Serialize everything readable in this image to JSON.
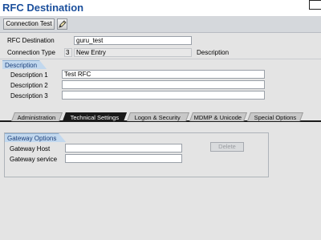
{
  "window": {
    "title": "RFC Destination"
  },
  "toolbar": {
    "connection_test_label": "Connection Test",
    "edit_icon": "pencil-icon"
  },
  "header": {
    "rfc_destination_label": "RFC Destination",
    "rfc_destination_value": "guru_test",
    "connection_type_label": "Connection Type",
    "connection_type_code": "3",
    "connection_type_text": "New Entry",
    "connection_type_desc_label": "Description"
  },
  "description": {
    "group_title": "Description",
    "desc1_label": "Description 1",
    "desc1_value": "Test RFC",
    "desc2_label": "Description 2",
    "desc2_value": "",
    "desc3_label": "Description 3",
    "desc3_value": ""
  },
  "tabs": [
    {
      "label": "Administration",
      "active": false
    },
    {
      "label": "Technical Settings",
      "active": true
    },
    {
      "label": "Logon & Security",
      "active": false
    },
    {
      "label": "MDMP & Unicode",
      "active": false
    },
    {
      "label": "Special Options",
      "active": false
    }
  ],
  "gateway": {
    "group_title": "Gateway Options",
    "host_label": "Gateway Host",
    "host_value": "",
    "service_label": "Gateway service",
    "service_value": "",
    "delete_label": "Delete"
  },
  "colors": {
    "title_blue": "#1b4f9c",
    "group_title_bg": "#c2d8ee",
    "active_tab_bg": "#1a1a1a",
    "background": "#e4e4e4"
  }
}
